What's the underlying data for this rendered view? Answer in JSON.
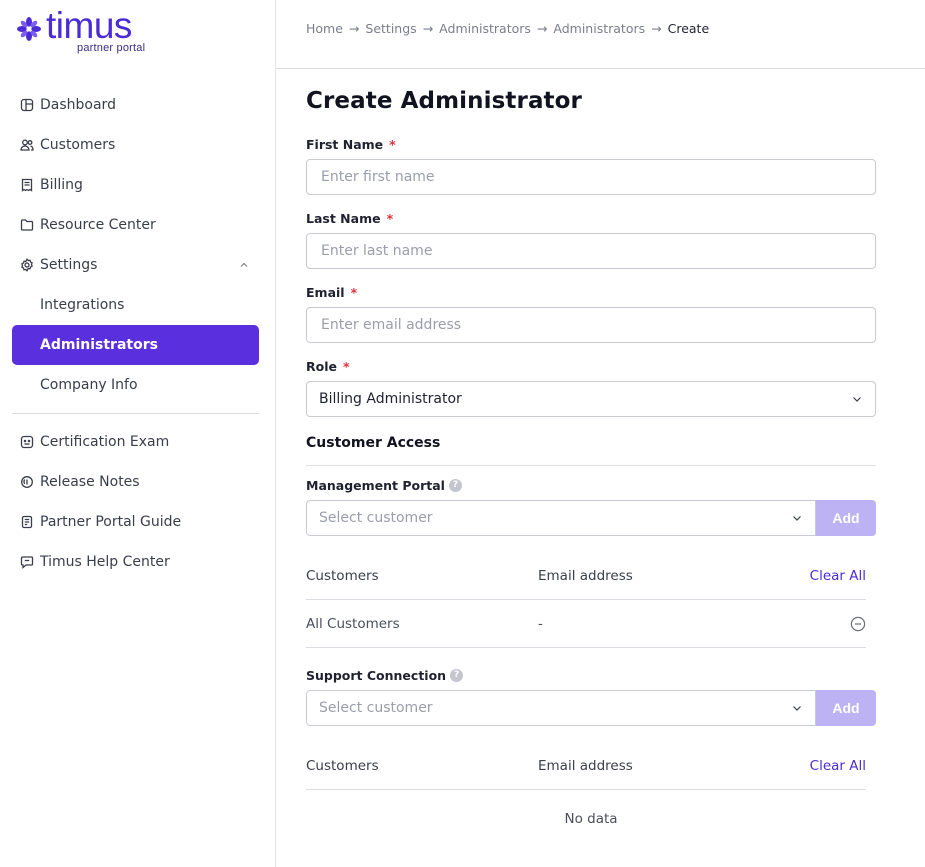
{
  "brand": {
    "name": "timus",
    "tagline": "partner portal",
    "color": "#4b2bd6"
  },
  "sidebar": {
    "items": [
      {
        "label": "Dashboard",
        "icon": "dashboard-icon"
      },
      {
        "label": "Customers",
        "icon": "users-icon"
      },
      {
        "label": "Billing",
        "icon": "receipt-icon"
      },
      {
        "label": "Resource Center",
        "icon": "folder-icon"
      },
      {
        "label": "Settings",
        "icon": "gear-icon",
        "expanded": true
      },
      {
        "label": "Integrations"
      },
      {
        "label": "Administrators",
        "active": true
      },
      {
        "label": "Company Info"
      },
      {
        "label": "Certification Exam",
        "icon": "exam-icon"
      },
      {
        "label": "Release Notes",
        "icon": "notes-icon"
      },
      {
        "label": "Partner Portal Guide",
        "icon": "book-icon"
      },
      {
        "label": "Timus Help Center",
        "icon": "chat-icon"
      }
    ],
    "active_color": "#5a2fde"
  },
  "breadcrumb": {
    "items": [
      "Home",
      "Settings",
      "Administrators",
      "Administrators",
      "Create"
    ],
    "separator": "→"
  },
  "page": {
    "title": "Create Administrator"
  },
  "form": {
    "required_mark": "*",
    "first_name": {
      "label": "First Name",
      "placeholder": "Enter first name",
      "value": ""
    },
    "last_name": {
      "label": "Last Name",
      "placeholder": "Enter last name",
      "value": ""
    },
    "email": {
      "label": "Email",
      "placeholder": "Enter email address",
      "value": ""
    },
    "role": {
      "label": "Role",
      "value": "Billing Administrator"
    }
  },
  "customer_access": {
    "title": "Customer Access",
    "management_portal": {
      "label": "Management Portal",
      "help": "?",
      "select_placeholder": "Select customer",
      "add_label": "Add",
      "table": {
        "headers": [
          "Customers",
          "Email address"
        ],
        "clear_all": "Clear All",
        "rows": [
          {
            "customer": "All Customers",
            "email": "-"
          }
        ]
      }
    },
    "support_connection": {
      "label": "Support Connection",
      "help": "?",
      "select_placeholder": "Select customer",
      "add_label": "Add",
      "table": {
        "headers": [
          "Customers",
          "Email address"
        ],
        "clear_all": "Clear All",
        "empty_text": "No data"
      }
    }
  }
}
